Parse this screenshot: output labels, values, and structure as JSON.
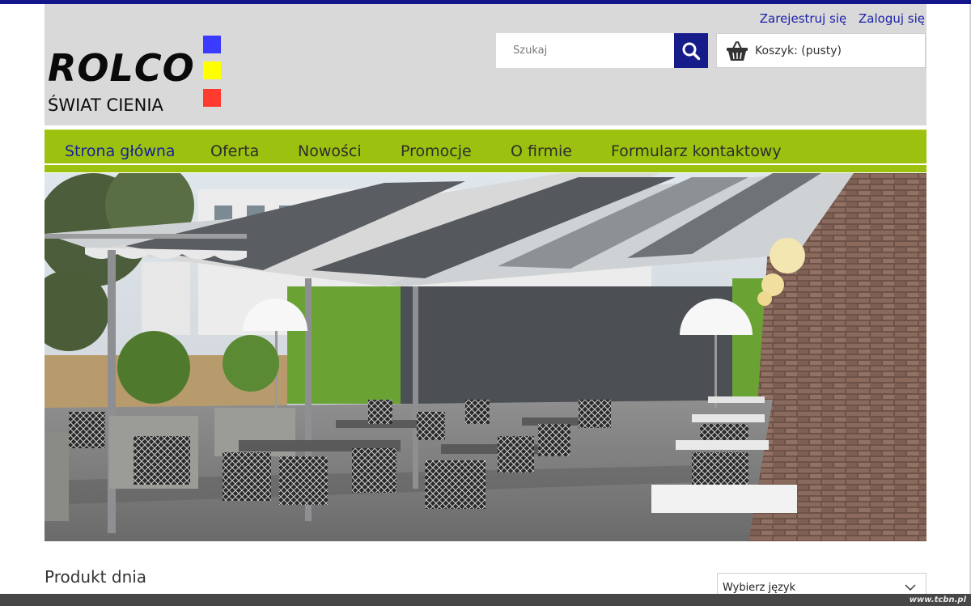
{
  "header": {
    "logo_title": "ROLCO",
    "logo_subtitle": "ŚWIAT CIENIA",
    "register_label": "Zarejestruj się",
    "login_label": "Zaloguj się",
    "search_placeholder": "Szukaj",
    "cart_label": "Koszyk: (pusty)",
    "logo_colors": [
      "#3b3bff",
      "#ffff00",
      "#ff3b30"
    ]
  },
  "nav": {
    "items": [
      {
        "label": "Strona główna",
        "active": true
      },
      {
        "label": "Oferta",
        "active": false
      },
      {
        "label": "Nowości",
        "active": false
      },
      {
        "label": "Promocje",
        "active": false
      },
      {
        "label": "O firmie",
        "active": false
      },
      {
        "label": "Formularz kontaktowy",
        "active": false
      }
    ]
  },
  "main": {
    "section_title": "Produkt dnia",
    "language_select": "Wybierz język"
  },
  "footer": {
    "watermark": "www.tcbn.pl"
  },
  "colors": {
    "accent_blue": "#161d8a",
    "nav_green": "#9cc10f",
    "header_gray": "#d9d9d9"
  }
}
